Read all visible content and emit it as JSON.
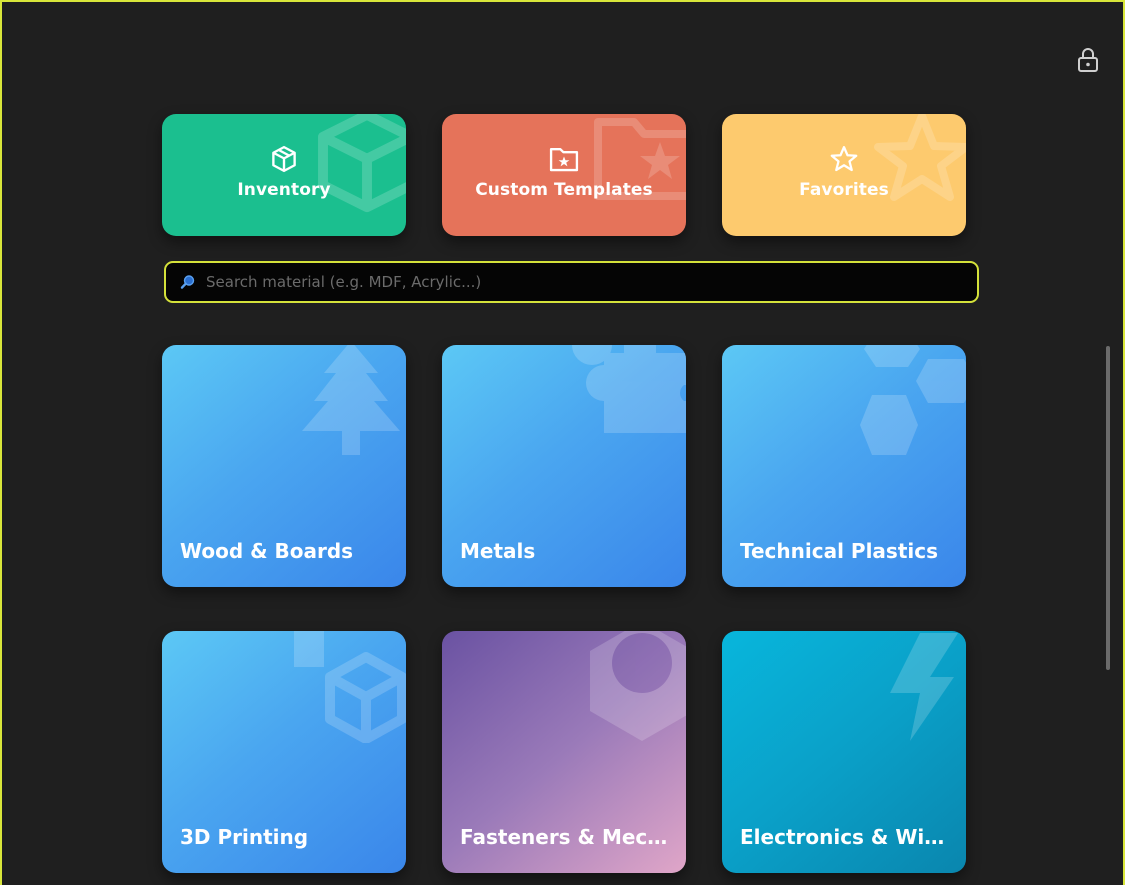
{
  "top_tiles": {
    "inventory": {
      "label": "Inventory",
      "color": "#1bbf8f",
      "icon": "box-icon"
    },
    "templates": {
      "label": "Custom Templates",
      "color": "#e5735a",
      "icon": "folder-star-icon"
    },
    "favorites": {
      "label": "Favorites",
      "color": "#fdca6e",
      "icon": "star-icon"
    }
  },
  "search": {
    "placeholder": "Search material (e.g. MDF, Acrylic...)",
    "value": "",
    "icon": "search-icon",
    "border_color": "#d4e13a"
  },
  "categories": [
    {
      "label": "Wood & Boards",
      "icon": "tree-icon"
    },
    {
      "label": "Metals",
      "icon": "gear-icon"
    },
    {
      "label": "Technical Plastics",
      "icon": "hexagon-icon"
    },
    {
      "label": "3D Printing",
      "icon": "cube-icon"
    },
    {
      "label": "Fasteners & Mech...",
      "icon": "hex-nut-icon"
    },
    {
      "label": "Electronics & Wiri...",
      "icon": "lightning-icon"
    }
  ],
  "header": {
    "icon": "lock-icon"
  },
  "frame_color": "#d8e63a"
}
